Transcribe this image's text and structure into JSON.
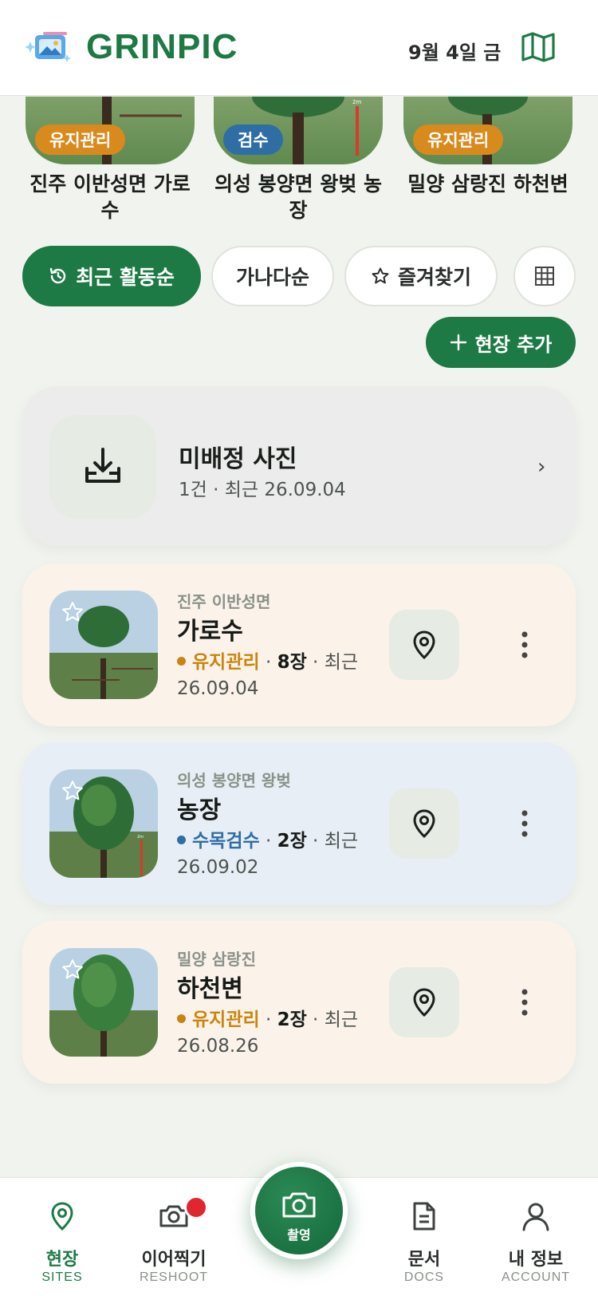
{
  "header": {
    "app_name": "GRINPIC",
    "date": "9월 4일 금",
    "logo_icon": "gallery-sparkle-icon",
    "map_icon": "map-icon"
  },
  "carousel": [
    {
      "title": "진주 이반성면 가로수",
      "badge": "유지관리",
      "badge_color": "#d98a1c"
    },
    {
      "title": "의성 봉양면 왕벚 농장",
      "badge": "검수",
      "badge_color": "#2f6ea5"
    },
    {
      "title": "밀양 삼랑진 하천변",
      "badge": "유지관리",
      "badge_color": "#d98a1c"
    }
  ],
  "filters": {
    "recent": "최근 활동순",
    "alpha": "가나다순",
    "favorites": "즐겨찾기",
    "grid_icon": "grid-icon"
  },
  "add_site_label": "현장 추가",
  "unsorted": {
    "title": "미배정 사진",
    "subtitle": "1건 · 최근 26.09.04",
    "icon": "download-tray-icon"
  },
  "sites": [
    {
      "region": "진주 이반성면",
      "name": "가로수",
      "status": "유지관리",
      "status_color": "#c9860e",
      "count": "8장",
      "recent": "최근 26.09.04",
      "bg": "#fbf2ea"
    },
    {
      "region": "의성 봉양면 왕벚",
      "name": "농장",
      "status": "수목검수",
      "status_color": "#2f6ea5",
      "count": "2장",
      "recent": "최근 26.09.02",
      "bg": "#e7eef5"
    },
    {
      "region": "밀양 삼랑진",
      "name": "하천변",
      "status": "유지관리",
      "status_color": "#c9860e",
      "count": "2장",
      "recent": "최근 26.08.26",
      "bg": "#fbf2ea"
    }
  ],
  "nav": {
    "sites": {
      "label": "현장",
      "sub": "SITES"
    },
    "reshoot": {
      "label": "이어찍기",
      "sub": "RESHOOT"
    },
    "capture": {
      "label": "촬영"
    },
    "docs": {
      "label": "문서",
      "sub": "DOCS"
    },
    "account": {
      "label": "내 정보",
      "sub": "ACCOUNT"
    }
  },
  "colors": {
    "brand": "#1d7a45",
    "maintenance": "#d98a1c",
    "inspection": "#2f6ea5",
    "notification": "#e0262e"
  }
}
